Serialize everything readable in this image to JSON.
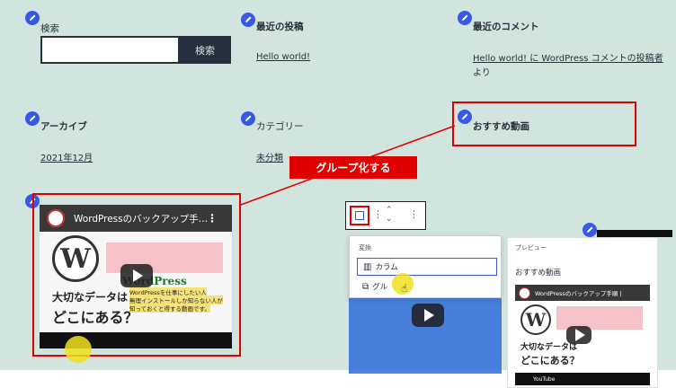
{
  "widgets": {
    "search": {
      "label": "検索",
      "button": "検索",
      "input_value": ""
    },
    "recent_posts": {
      "title": "最近の投稿",
      "link": "Hello world!"
    },
    "recent_comments": {
      "title": "最近のコメント",
      "text": "Hello world! に WordPress コメントの投稿者",
      "text2": "より"
    },
    "archives": {
      "title": "アーカイブ",
      "link": "2021年12月"
    },
    "categories": {
      "title": "カテゴリー",
      "link": "未分類"
    },
    "recommended": {
      "title": "おすすめ動画"
    }
  },
  "callout": {
    "text": "グループ化する"
  },
  "video": {
    "title": "WordPressのバックアップ手…",
    "thumb_brand": "WordPress",
    "thumb_line1": "大切なデータは",
    "thumb_line2": "どこにある？",
    "thumb_sub": "WordPressを仕事にしたい人",
    "thumb_sub2": "無理インストールしか知らない人が",
    "thumb_sub3": "知っておくと得する動画です。"
  },
  "transform_menu": {
    "heading": "変換",
    "items": [
      {
        "label": "カラム",
        "icon": "columns-icon"
      },
      {
        "label": "グル",
        "icon": "group-icon"
      }
    ]
  },
  "preview": {
    "heading": "プレビュー",
    "title": "おすすめ動画",
    "video_title": "WordPressのバックアップ手順 |",
    "youtube": "YouTube"
  },
  "colors": {
    "accent": "#3858e9",
    "highlight": "#e00000",
    "background": "#d1e4dd"
  }
}
